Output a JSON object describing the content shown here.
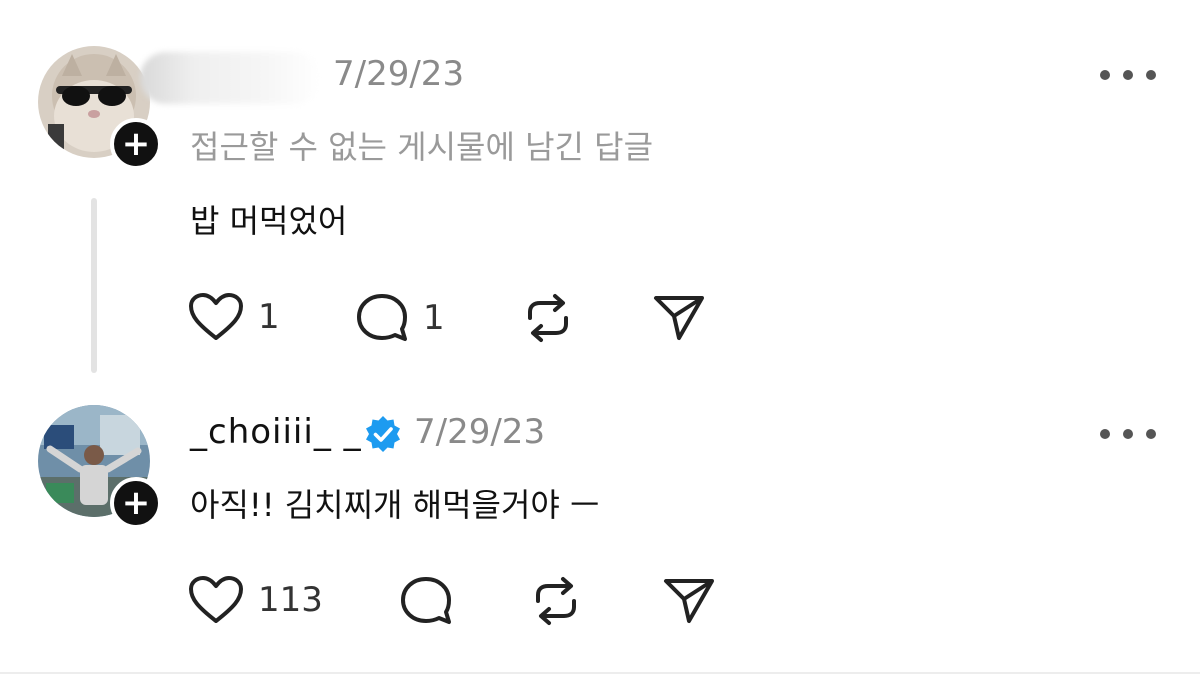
{
  "post1": {
    "timestamp": "7/29/23",
    "context_note": "접근할 수 없는 게시물에 남긴 답글",
    "body": "밥 머먹었어",
    "likes": "1",
    "replies": "1"
  },
  "post2": {
    "username": "_choiiii_ _",
    "timestamp": "7/29/23",
    "body": "아직!! 김치찌개 해먹을거야 ㅡ",
    "likes": "113"
  },
  "colors": {
    "verified": "#1d9bf0",
    "muted_text": "#8a8a8a",
    "icon": "#222222"
  }
}
